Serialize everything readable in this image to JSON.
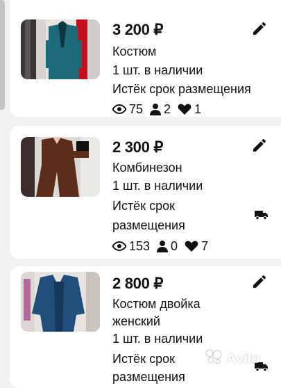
{
  "listings": [
    {
      "price": "3 200 ₽",
      "title": "Костюм",
      "stock": "1 шт. в наличии",
      "status": "Истёк срок размещения",
      "views": "75",
      "contacts": "2",
      "favorites": "1",
      "thumb_icon": "teal-suit-photo"
    },
    {
      "price": "2 300 ₽",
      "title": "Комбинезон",
      "stock": "1 шт. в наличии",
      "status_line1": "Истёк срок",
      "status_line2": "размещения",
      "views": "153",
      "contacts": "0",
      "favorites": "7",
      "thumb_icon": "brown-jumpsuit-photo"
    },
    {
      "price": "2 800 ₽",
      "title_line1": "Костюм двойка",
      "title_line2": "женский",
      "stock": "1 шт. в наличии",
      "status_line1": "Истёк срок",
      "status_line2": "размещения",
      "thumb_icon": "blue-blazer-photo"
    }
  ],
  "watermark": "Avito",
  "colors": {
    "text": "#111111",
    "background": "#f2f2f2",
    "card": "#ffffff"
  }
}
